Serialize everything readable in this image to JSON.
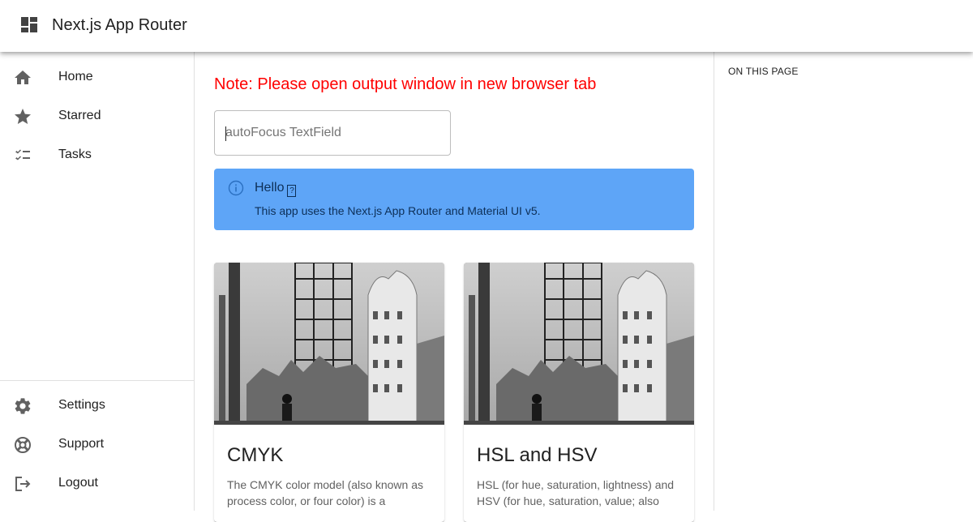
{
  "appbar": {
    "title": "Next.js App Router",
    "logo_icon": "dashboard-icon"
  },
  "drawer": {
    "top_items": [
      {
        "label": "Home",
        "icon": "home-icon"
      },
      {
        "label": "Starred",
        "icon": "star-icon"
      },
      {
        "label": "Tasks",
        "icon": "checklist-icon"
      }
    ],
    "bottom_items": [
      {
        "label": "Settings",
        "icon": "gear-icon"
      },
      {
        "label": "Support",
        "icon": "support-icon"
      },
      {
        "label": "Logout",
        "icon": "logout-icon"
      }
    ]
  },
  "main": {
    "note": "Note: Please open output window in new browser tab",
    "textfield": {
      "placeholder": "autoFocus TextField",
      "value": ""
    },
    "alert": {
      "title": "Hello",
      "glyph": "?",
      "body": "This app uses the Next.js App Router and Material UI v5.",
      "color": "#5ea5f7"
    },
    "cards": [
      {
        "title": "CMYK",
        "text": "The CMYK color model (also known as process color, or four color) is a"
      },
      {
        "title": "HSL and HSV",
        "text": "HSL (for hue, saturation, lightness) and HSV (for hue, saturation, value; also"
      }
    ]
  },
  "toc": {
    "title": "ON THIS PAGE"
  },
  "colors": {
    "note": "#ff0000",
    "alert_bg": "#5ea5f7",
    "alert_text": "#0d2f57"
  }
}
